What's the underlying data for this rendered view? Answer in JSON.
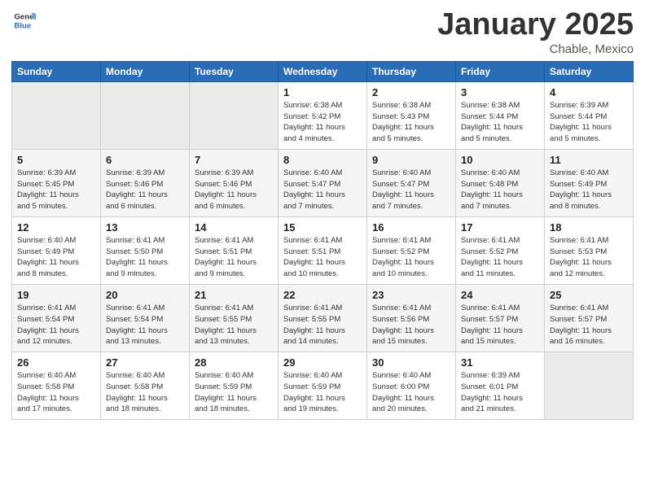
{
  "logo": {
    "line1": "General",
    "line2": "Blue"
  },
  "header": {
    "month": "January 2025",
    "location": "Chable, Mexico"
  },
  "days_of_week": [
    "Sunday",
    "Monday",
    "Tuesday",
    "Wednesday",
    "Thursday",
    "Friday",
    "Saturday"
  ],
  "weeks": [
    [
      {
        "num": "",
        "info": ""
      },
      {
        "num": "",
        "info": ""
      },
      {
        "num": "",
        "info": ""
      },
      {
        "num": "1",
        "info": "Sunrise: 6:38 AM\nSunset: 5:42 PM\nDaylight: 11 hours\nand 4 minutes."
      },
      {
        "num": "2",
        "info": "Sunrise: 6:38 AM\nSunset: 5:43 PM\nDaylight: 11 hours\nand 5 minutes."
      },
      {
        "num": "3",
        "info": "Sunrise: 6:38 AM\nSunset: 5:44 PM\nDaylight: 11 hours\nand 5 minutes."
      },
      {
        "num": "4",
        "info": "Sunrise: 6:39 AM\nSunset: 5:44 PM\nDaylight: 11 hours\nand 5 minutes."
      }
    ],
    [
      {
        "num": "5",
        "info": "Sunrise: 6:39 AM\nSunset: 5:45 PM\nDaylight: 11 hours\nand 5 minutes."
      },
      {
        "num": "6",
        "info": "Sunrise: 6:39 AM\nSunset: 5:46 PM\nDaylight: 11 hours\nand 6 minutes."
      },
      {
        "num": "7",
        "info": "Sunrise: 6:39 AM\nSunset: 5:46 PM\nDaylight: 11 hours\nand 6 minutes."
      },
      {
        "num": "8",
        "info": "Sunrise: 6:40 AM\nSunset: 5:47 PM\nDaylight: 11 hours\nand 7 minutes."
      },
      {
        "num": "9",
        "info": "Sunrise: 6:40 AM\nSunset: 5:47 PM\nDaylight: 11 hours\nand 7 minutes."
      },
      {
        "num": "10",
        "info": "Sunrise: 6:40 AM\nSunset: 5:48 PM\nDaylight: 11 hours\nand 7 minutes."
      },
      {
        "num": "11",
        "info": "Sunrise: 6:40 AM\nSunset: 5:49 PM\nDaylight: 11 hours\nand 8 minutes."
      }
    ],
    [
      {
        "num": "12",
        "info": "Sunrise: 6:40 AM\nSunset: 5:49 PM\nDaylight: 11 hours\nand 8 minutes."
      },
      {
        "num": "13",
        "info": "Sunrise: 6:41 AM\nSunset: 5:50 PM\nDaylight: 11 hours\nand 9 minutes."
      },
      {
        "num": "14",
        "info": "Sunrise: 6:41 AM\nSunset: 5:51 PM\nDaylight: 11 hours\nand 9 minutes."
      },
      {
        "num": "15",
        "info": "Sunrise: 6:41 AM\nSunset: 5:51 PM\nDaylight: 11 hours\nand 10 minutes."
      },
      {
        "num": "16",
        "info": "Sunrise: 6:41 AM\nSunset: 5:52 PM\nDaylight: 11 hours\nand 10 minutes."
      },
      {
        "num": "17",
        "info": "Sunrise: 6:41 AM\nSunset: 5:52 PM\nDaylight: 11 hours\nand 11 minutes."
      },
      {
        "num": "18",
        "info": "Sunrise: 6:41 AM\nSunset: 5:53 PM\nDaylight: 11 hours\nand 12 minutes."
      }
    ],
    [
      {
        "num": "19",
        "info": "Sunrise: 6:41 AM\nSunset: 5:54 PM\nDaylight: 11 hours\nand 12 minutes."
      },
      {
        "num": "20",
        "info": "Sunrise: 6:41 AM\nSunset: 5:54 PM\nDaylight: 11 hours\nand 13 minutes."
      },
      {
        "num": "21",
        "info": "Sunrise: 6:41 AM\nSunset: 5:55 PM\nDaylight: 11 hours\nand 13 minutes."
      },
      {
        "num": "22",
        "info": "Sunrise: 6:41 AM\nSunset: 5:55 PM\nDaylight: 11 hours\nand 14 minutes."
      },
      {
        "num": "23",
        "info": "Sunrise: 6:41 AM\nSunset: 5:56 PM\nDaylight: 11 hours\nand 15 minutes."
      },
      {
        "num": "24",
        "info": "Sunrise: 6:41 AM\nSunset: 5:57 PM\nDaylight: 11 hours\nand 15 minutes."
      },
      {
        "num": "25",
        "info": "Sunrise: 6:41 AM\nSunset: 5:57 PM\nDaylight: 11 hours\nand 16 minutes."
      }
    ],
    [
      {
        "num": "26",
        "info": "Sunrise: 6:40 AM\nSunset: 5:58 PM\nDaylight: 11 hours\nand 17 minutes."
      },
      {
        "num": "27",
        "info": "Sunrise: 6:40 AM\nSunset: 5:58 PM\nDaylight: 11 hours\nand 18 minutes."
      },
      {
        "num": "28",
        "info": "Sunrise: 6:40 AM\nSunset: 5:59 PM\nDaylight: 11 hours\nand 18 minutes."
      },
      {
        "num": "29",
        "info": "Sunrise: 6:40 AM\nSunset: 5:59 PM\nDaylight: 11 hours\nand 19 minutes."
      },
      {
        "num": "30",
        "info": "Sunrise: 6:40 AM\nSunset: 6:00 PM\nDaylight: 11 hours\nand 20 minutes."
      },
      {
        "num": "31",
        "info": "Sunrise: 6:39 AM\nSunset: 6:01 PM\nDaylight: 11 hours\nand 21 minutes."
      },
      {
        "num": "",
        "info": ""
      }
    ]
  ]
}
